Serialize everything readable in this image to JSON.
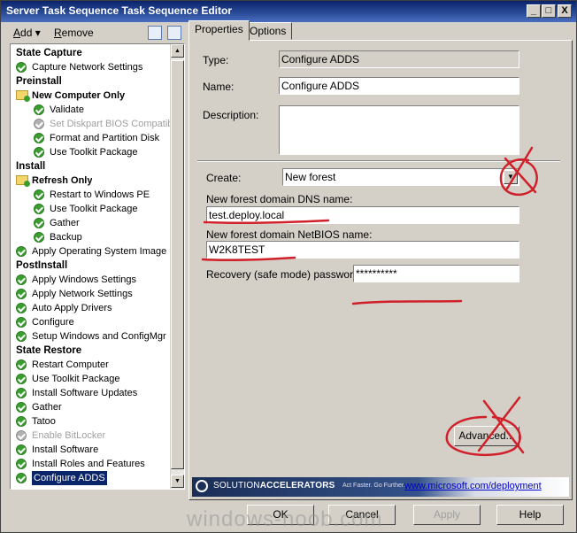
{
  "window": {
    "title": "Server Task Sequence Task Sequence Editor",
    "controls": {
      "minimize": "_",
      "maximize": "□",
      "close": "X"
    }
  },
  "toolbar": {
    "add_label": "Add",
    "add_underline": "A",
    "add_rest": "dd",
    "remove_label": "Remove",
    "remove_underline": "R",
    "remove_rest": "emove"
  },
  "tree": [
    {
      "label": "State Capture",
      "type": "group",
      "level": 0
    },
    {
      "label": "Capture Network Settings",
      "type": "step",
      "level": 1,
      "status": "ok"
    },
    {
      "label": "Preinstall",
      "type": "group",
      "level": 0
    },
    {
      "label": "New Computer Only",
      "type": "folder",
      "level": 1
    },
    {
      "label": "Validate",
      "type": "step",
      "level": 2,
      "status": "ok"
    },
    {
      "label": "Set Diskpart BIOS Compatibi",
      "type": "step",
      "level": 2,
      "status": "disabled"
    },
    {
      "label": "Format and Partition Disk",
      "type": "step",
      "level": 2,
      "status": "ok"
    },
    {
      "label": "Use Toolkit Package",
      "type": "step",
      "level": 2,
      "status": "ok"
    },
    {
      "label": "Install",
      "type": "group",
      "level": 0
    },
    {
      "label": "Refresh Only",
      "type": "folder",
      "level": 1
    },
    {
      "label": "Restart to Windows PE",
      "type": "step",
      "level": 2,
      "status": "ok"
    },
    {
      "label": "Use Toolkit Package",
      "type": "step",
      "level": 2,
      "status": "ok"
    },
    {
      "label": "Gather",
      "type": "step",
      "level": 2,
      "status": "ok"
    },
    {
      "label": "Backup",
      "type": "step",
      "level": 2,
      "status": "ok"
    },
    {
      "label": "Apply Operating System Image",
      "type": "step",
      "level": 1,
      "status": "ok"
    },
    {
      "label": "PostInstall",
      "type": "group",
      "level": 0
    },
    {
      "label": "Apply Windows Settings",
      "type": "step",
      "level": 1,
      "status": "ok"
    },
    {
      "label": "Apply Network Settings",
      "type": "step",
      "level": 1,
      "status": "ok"
    },
    {
      "label": "Auto Apply Drivers",
      "type": "step",
      "level": 1,
      "status": "ok"
    },
    {
      "label": "Configure",
      "type": "step",
      "level": 1,
      "status": "ok"
    },
    {
      "label": "Setup Windows and ConfigMgr",
      "type": "step",
      "level": 1,
      "status": "ok"
    },
    {
      "label": "State Restore",
      "type": "group",
      "level": 0
    },
    {
      "label": "Restart Computer",
      "type": "step",
      "level": 1,
      "status": "ok"
    },
    {
      "label": "Use Toolkit Package",
      "type": "step",
      "level": 1,
      "status": "ok"
    },
    {
      "label": "Install Software Updates",
      "type": "step",
      "level": 1,
      "status": "ok"
    },
    {
      "label": "Gather",
      "type": "step",
      "level": 1,
      "status": "ok"
    },
    {
      "label": "Tatoo",
      "type": "step",
      "level": 1,
      "status": "ok"
    },
    {
      "label": "Enable BitLocker",
      "type": "step",
      "level": 1,
      "status": "disabled"
    },
    {
      "label": "Install Software",
      "type": "step",
      "level": 1,
      "status": "ok"
    },
    {
      "label": "Install Roles and Features",
      "type": "step",
      "level": 1,
      "status": "ok"
    },
    {
      "label": "Configure ADDS",
      "type": "step",
      "level": 1,
      "status": "ok",
      "selected": true
    }
  ],
  "tabs": {
    "properties": "Properties",
    "options": "Options"
  },
  "form": {
    "type_label": "Type:",
    "type_value": "Configure ADDS",
    "name_label": "Name:",
    "name_value": "Configure ADDS",
    "description_label": "Description:",
    "description_value": "",
    "create_label": "Create:",
    "create_value": "New forest",
    "dns_label": "New forest domain DNS name:",
    "dns_value": "test.deploy.local",
    "netbios_label": "New forest domain NetBIOS name:",
    "netbios_value": "W2K8TEST",
    "password_label": "Recovery (safe mode) password:",
    "password_value": "**********",
    "advanced_button": "Advanced..."
  },
  "banner": {
    "brand_light": "SOLUTION",
    "brand_bold": "ACCELERATORS",
    "tagline": "Act Faster. Go Further.",
    "link": "www.microsoft.com/deployment"
  },
  "buttons": {
    "ok": "OK",
    "cancel": "Cancel",
    "apply": "Apply",
    "help": "Help"
  },
  "watermark": "windows-noob.com",
  "colors": {
    "annotation": "#d0202a",
    "title_bar": "#0a246a",
    "selection": "#0a246a",
    "status_ok": "#3a9e2f"
  }
}
